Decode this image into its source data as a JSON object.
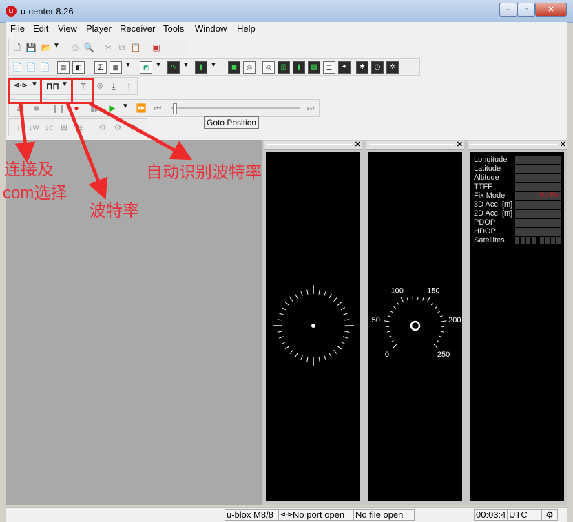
{
  "window": {
    "title": "u-center 8.26",
    "logo_letter": "u",
    "min": "‒",
    "max": "▫",
    "close": "✕"
  },
  "menu": [
    "File",
    "Edit",
    "View",
    "Player",
    "Receiver",
    "Tools",
    "Window",
    "Help"
  ],
  "tooltip": "Goto Position",
  "annotations": {
    "connect": "连接及",
    "com": "com选择",
    "baud": "波特率",
    "auto_baud": "自动识别波特率"
  },
  "data_panel": {
    "rows": [
      {
        "label": "Longitude",
        "value": ""
      },
      {
        "label": "Latitude",
        "value": ""
      },
      {
        "label": "Altitude",
        "value": ""
      },
      {
        "label": "TTFF",
        "value": ""
      },
      {
        "label": "Fix Mode",
        "value": "No Fix"
      },
      {
        "label": "3D Acc. [m]",
        "value": ""
      },
      {
        "label": "2D Acc. [m]",
        "value": ""
      },
      {
        "label": "PDOP",
        "value": ""
      },
      {
        "label": "HDOP",
        "value": ""
      },
      {
        "label": "Satellites",
        "value": ""
      }
    ]
  },
  "speedometer": {
    "labels": [
      "0",
      "50",
      "100",
      "150",
      "200",
      "250"
    ]
  },
  "status": {
    "receiver": "u-blox M8/8",
    "port": "No port open",
    "file": "No file open",
    "time": "00:03:4",
    "tz": "UTC"
  },
  "colors": {
    "accent_red": "#e8323c",
    "panel_bg": "#000000",
    "fix_mode_red": "#c11a1a"
  }
}
